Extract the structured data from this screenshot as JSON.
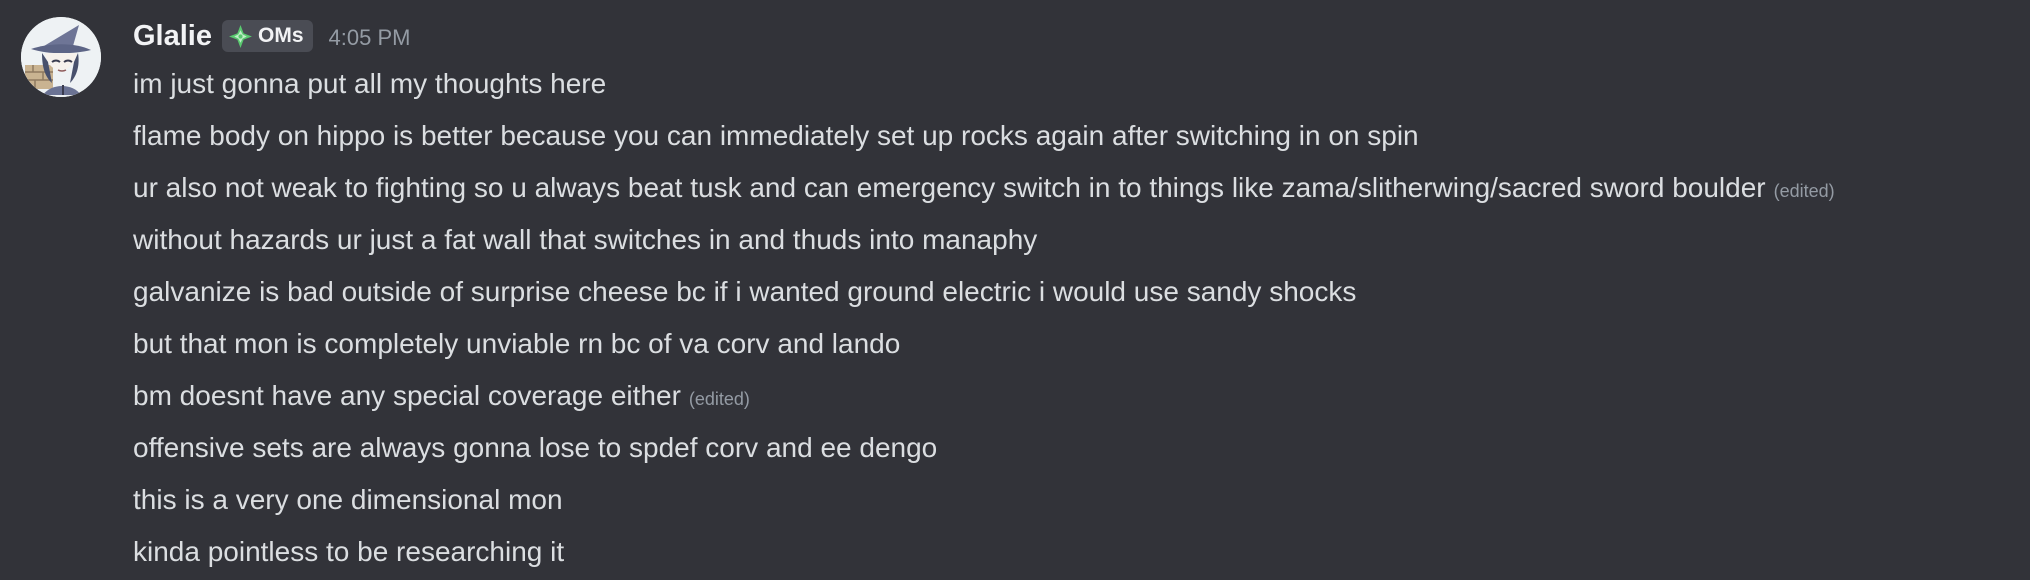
{
  "message": {
    "author": "Glalie",
    "role_tag": "OMs",
    "timestamp": "4:05 PM",
    "lines": [
      {
        "text": "im just gonna put all my thoughts here",
        "edited": ""
      },
      {
        "text": "flame body on hippo is better because you can immediately set up rocks again after switching in on spin",
        "edited": ""
      },
      {
        "text": "ur also not weak to fighting so u always beat tusk and can emergency switch in to things like zama/slitherwing/sacred sword boulder",
        "edited": "(edited)"
      },
      {
        "text": "without hazards ur just a fat wall that switches in and thuds into manaphy",
        "edited": ""
      },
      {
        "text": "galvanize is bad outside of surprise cheese bc if i wanted ground electric i would use sandy shocks",
        "edited": ""
      },
      {
        "text": "but that mon is completely unviable rn bc of va corv and lando",
        "edited": ""
      },
      {
        "text": "bm doesnt have any special coverage either",
        "edited": "(edited)"
      },
      {
        "text": "offensive sets are always gonna lose to spdef corv and ee dengo",
        "edited": ""
      },
      {
        "text": "this is a very one dimensional mon",
        "edited": ""
      },
      {
        "text": "kinda pointless to be researching it",
        "edited": ""
      }
    ]
  },
  "icons": {
    "avatar": "witch-avatar-icon",
    "role": "sparkle-diamond-icon"
  },
  "colors": {
    "background": "#323339",
    "username": "#f2f3f5",
    "text": "#dbdee1",
    "muted": "#949ba4",
    "role_bg": "#4a4c54",
    "role_icon": "#59c96f"
  }
}
